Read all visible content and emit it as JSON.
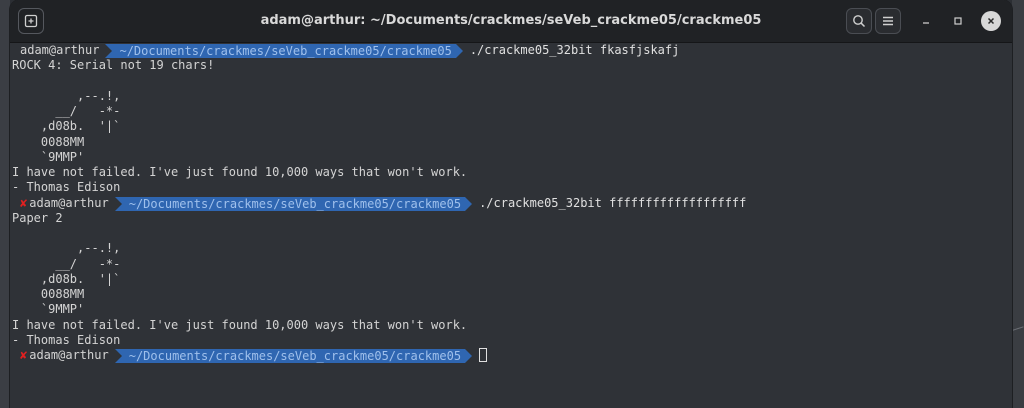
{
  "window": {
    "title": "adam@arthur: ~/Documents/crackmes/seVeb_crackme05/crackme05"
  },
  "terminal": {
    "prompt_user": "adam@arthur",
    "prompt_path": "~/Documents/crackmes/seVeb_crackme05/crackme05",
    "error_mark": "✘",
    "commands": [
      "./crackme05_32bit fkasfjskafj",
      "./crackme05_32bit fffffffffffffffffff"
    ],
    "output1": [
      "ROCK 4: Serial not 19 chars!",
      "",
      "         ,--.!,",
      "      __/   -*-",
      "    ,d08b.  '|`",
      "    0088MM",
      "    `9MMP'",
      "I have not failed. I've just found 10,000 ways that won't work.",
      "- Thomas Edison"
    ],
    "output2": [
      "Paper 2",
      "",
      "         ,--.!,",
      "      __/   -*-",
      "    ,d08b.  '|`",
      "    0088MM",
      "    `9MMP'",
      "I have not failed. I've just found 10,000 ways that won't work.",
      "- Thomas Edison"
    ]
  },
  "icons": {
    "new_tab": "new-tab-icon",
    "search": "search-icon",
    "menu": "hamburger-menu-icon",
    "minimize": "minimize-icon",
    "maximize": "maximize-icon",
    "close": "close-icon"
  }
}
